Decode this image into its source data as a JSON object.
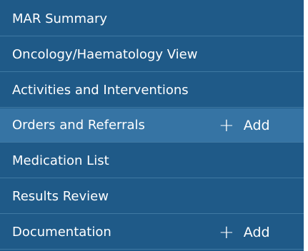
{
  "nav": {
    "items": [
      {
        "label": "MAR Summary",
        "active": false
      },
      {
        "label": "Oncology/Haematology View",
        "active": false
      },
      {
        "label": "Activities and Interventions",
        "active": false
      },
      {
        "label": "Orders and Referrals",
        "active": true,
        "add_label": "Add",
        "add_icon": "plus-icon"
      },
      {
        "label": "Medication List",
        "active": false
      },
      {
        "label": "Results Review",
        "active": false
      },
      {
        "label": "Documentation",
        "active": false,
        "add_label": "Add",
        "add_icon": "plus-icon"
      }
    ]
  },
  "colors": {
    "background": "#1f5a88",
    "active": "#3674a4",
    "divider": "#3f79a3",
    "text": "#ffffff"
  }
}
